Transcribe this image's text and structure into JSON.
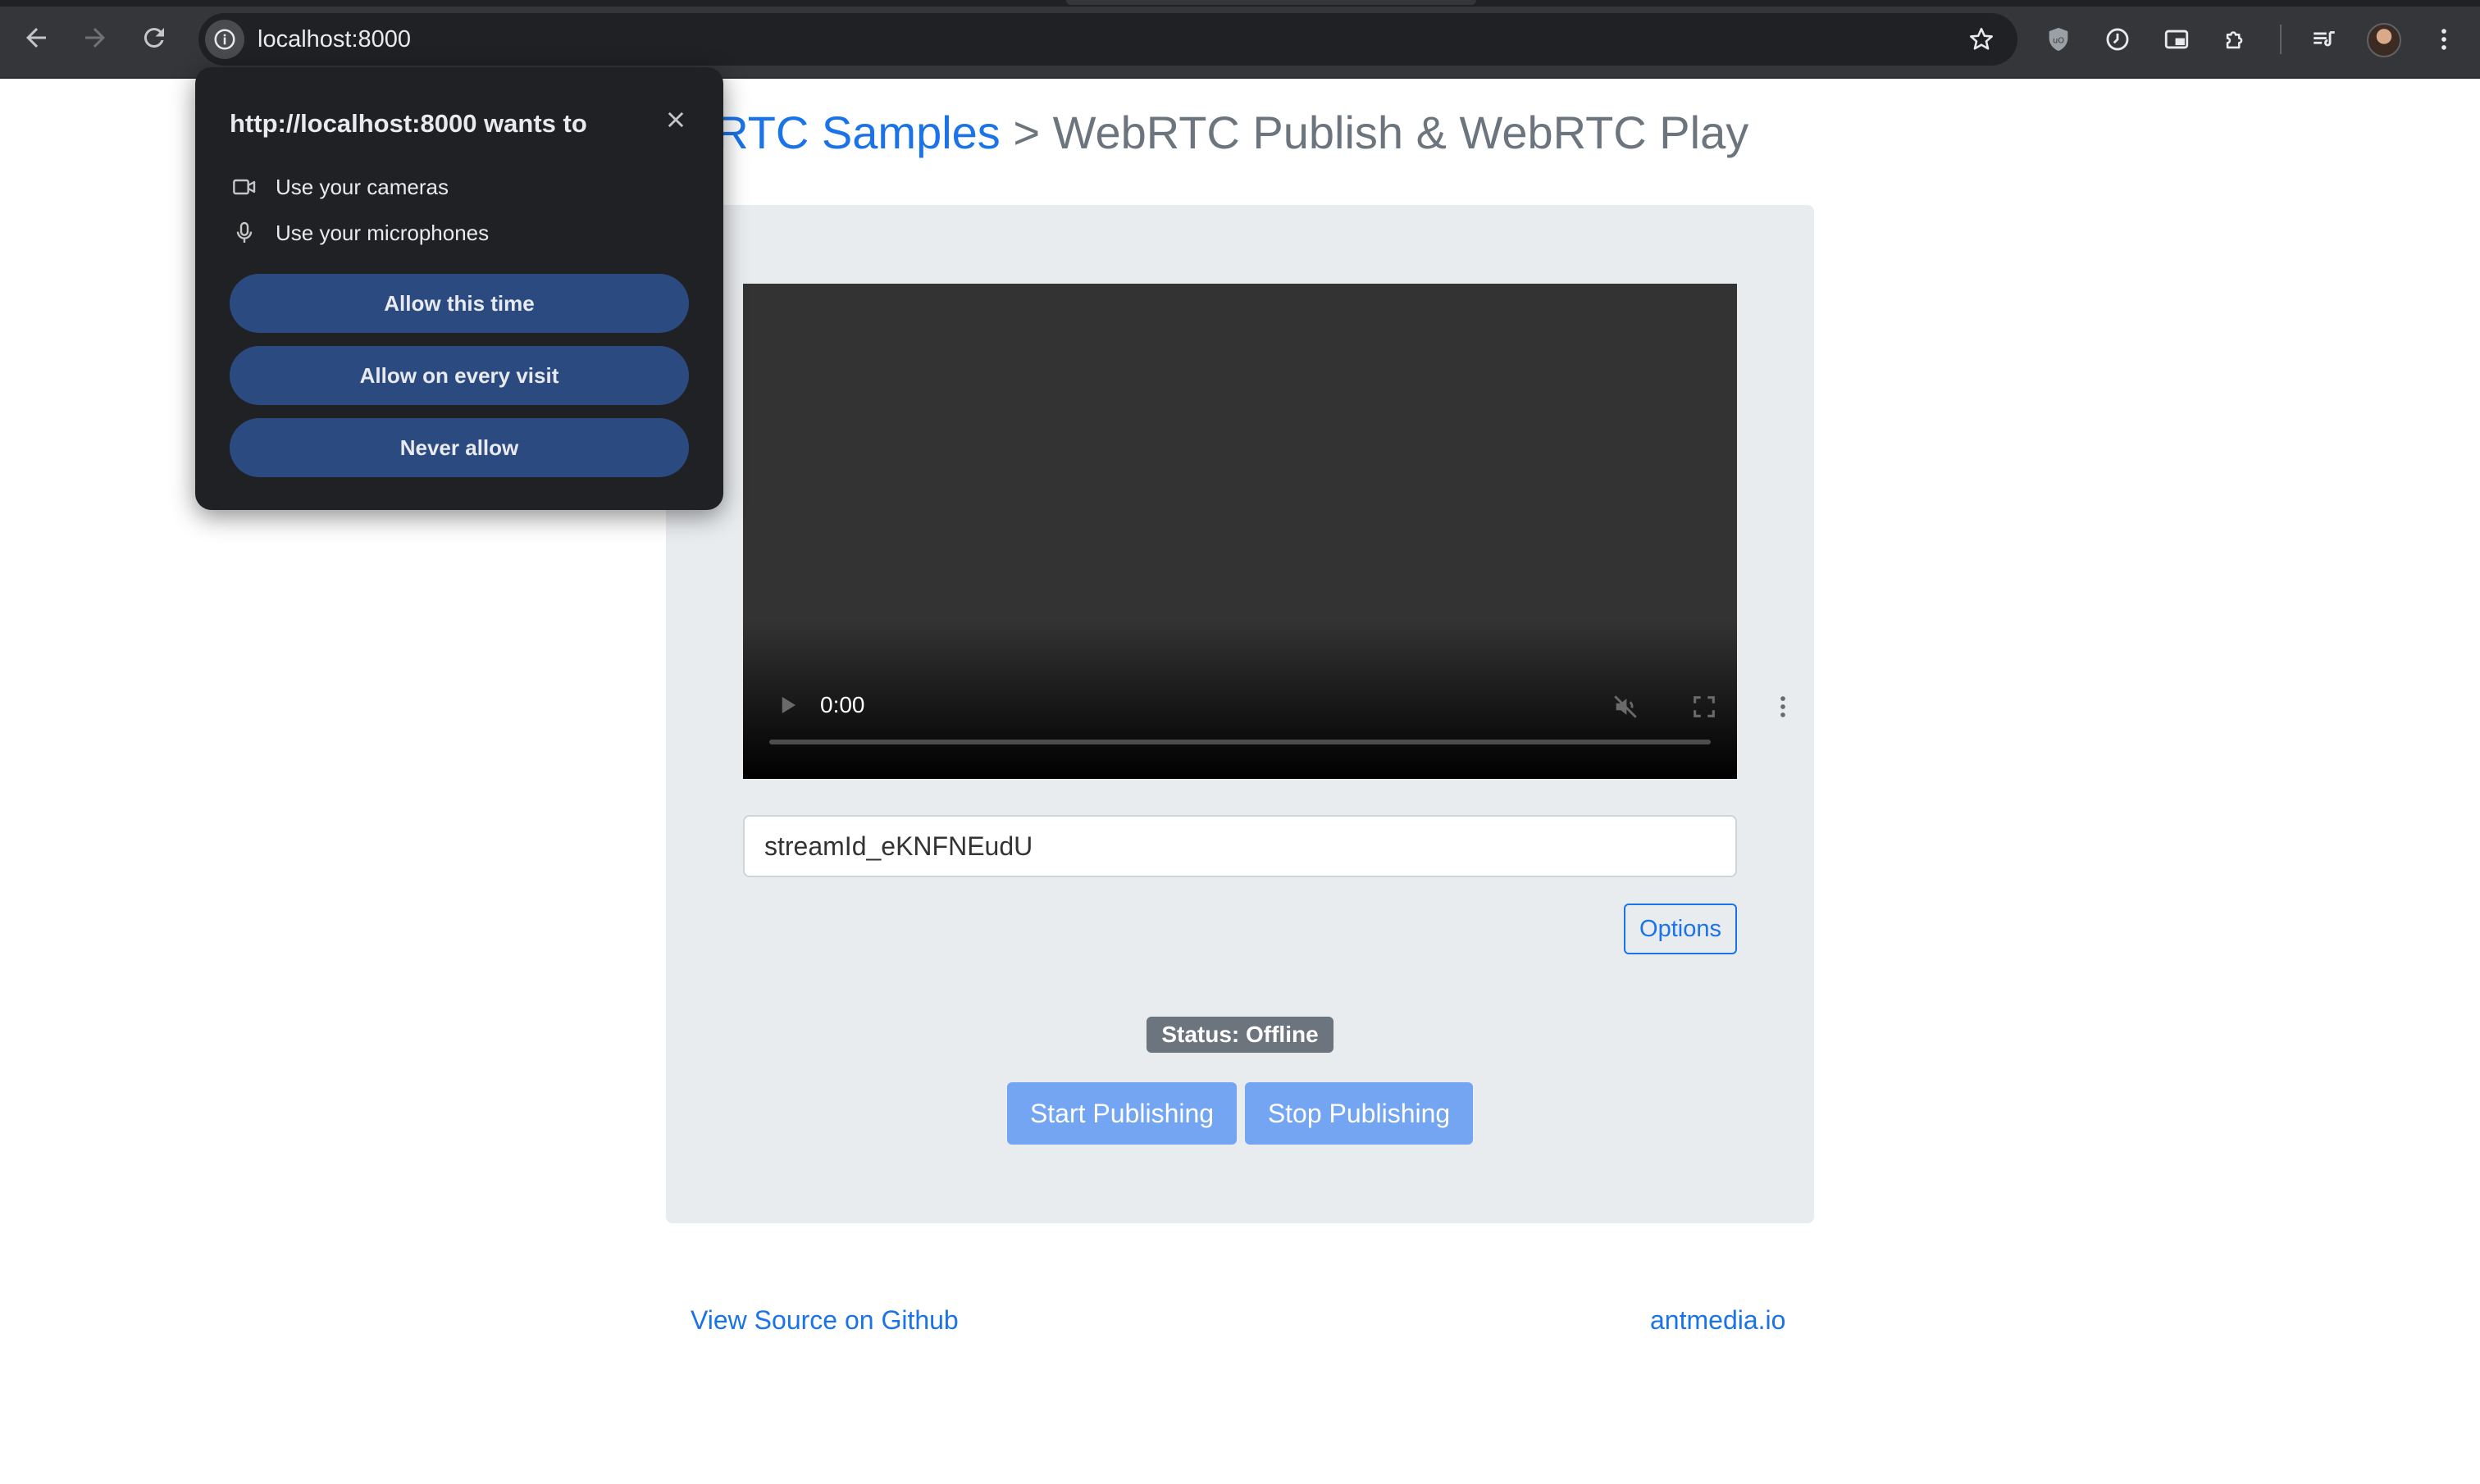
{
  "browser": {
    "url": "localhost:8000",
    "icons": {
      "back": "back-arrow-icon",
      "forward": "forward-arrow-icon",
      "reload": "reload-icon",
      "site_info": "info-icon",
      "bookmark": "star-icon",
      "extensions": [
        "ublock-shield-icon",
        "clock-icon",
        "picture-in-picture-icon",
        "puzzle-extensions-icon",
        "media-queue-icon"
      ],
      "profile": "avatar",
      "menu": "kebab-menu-icon"
    }
  },
  "permission_popup": {
    "title": "http://localhost:8000 wants to",
    "items": [
      {
        "icon": "camera-icon",
        "label": "Use your cameras"
      },
      {
        "icon": "microphone-icon",
        "label": "Use your microphones"
      }
    ],
    "buttons": {
      "allow_once": "Allow this time",
      "allow_always": "Allow on every visit",
      "never": "Never allow"
    }
  },
  "page": {
    "breadcrumb_link": "ebRTC Samples",
    "breadcrumb_rest": " > WebRTC Publish & WebRTC Play",
    "video": {
      "time": "0:00",
      "progress": 0
    },
    "stream_id": "streamId_eKNFNEudU",
    "options_label": "Options",
    "status": "Status: Offline",
    "start_label": "Start Publishing",
    "stop_label": "Stop Publishing",
    "footer": {
      "source_link": "View Source on Github",
      "site_link": "antmedia.io"
    }
  },
  "colors": {
    "chrome_bg": "#35363a",
    "omnibox_bg": "#202124",
    "link_blue": "#1a73e8",
    "card_bg": "#e9ecef",
    "badge_gray": "#6c757d",
    "publish_btn": "#73a5f2",
    "popup_btn": "#2b4b80"
  }
}
